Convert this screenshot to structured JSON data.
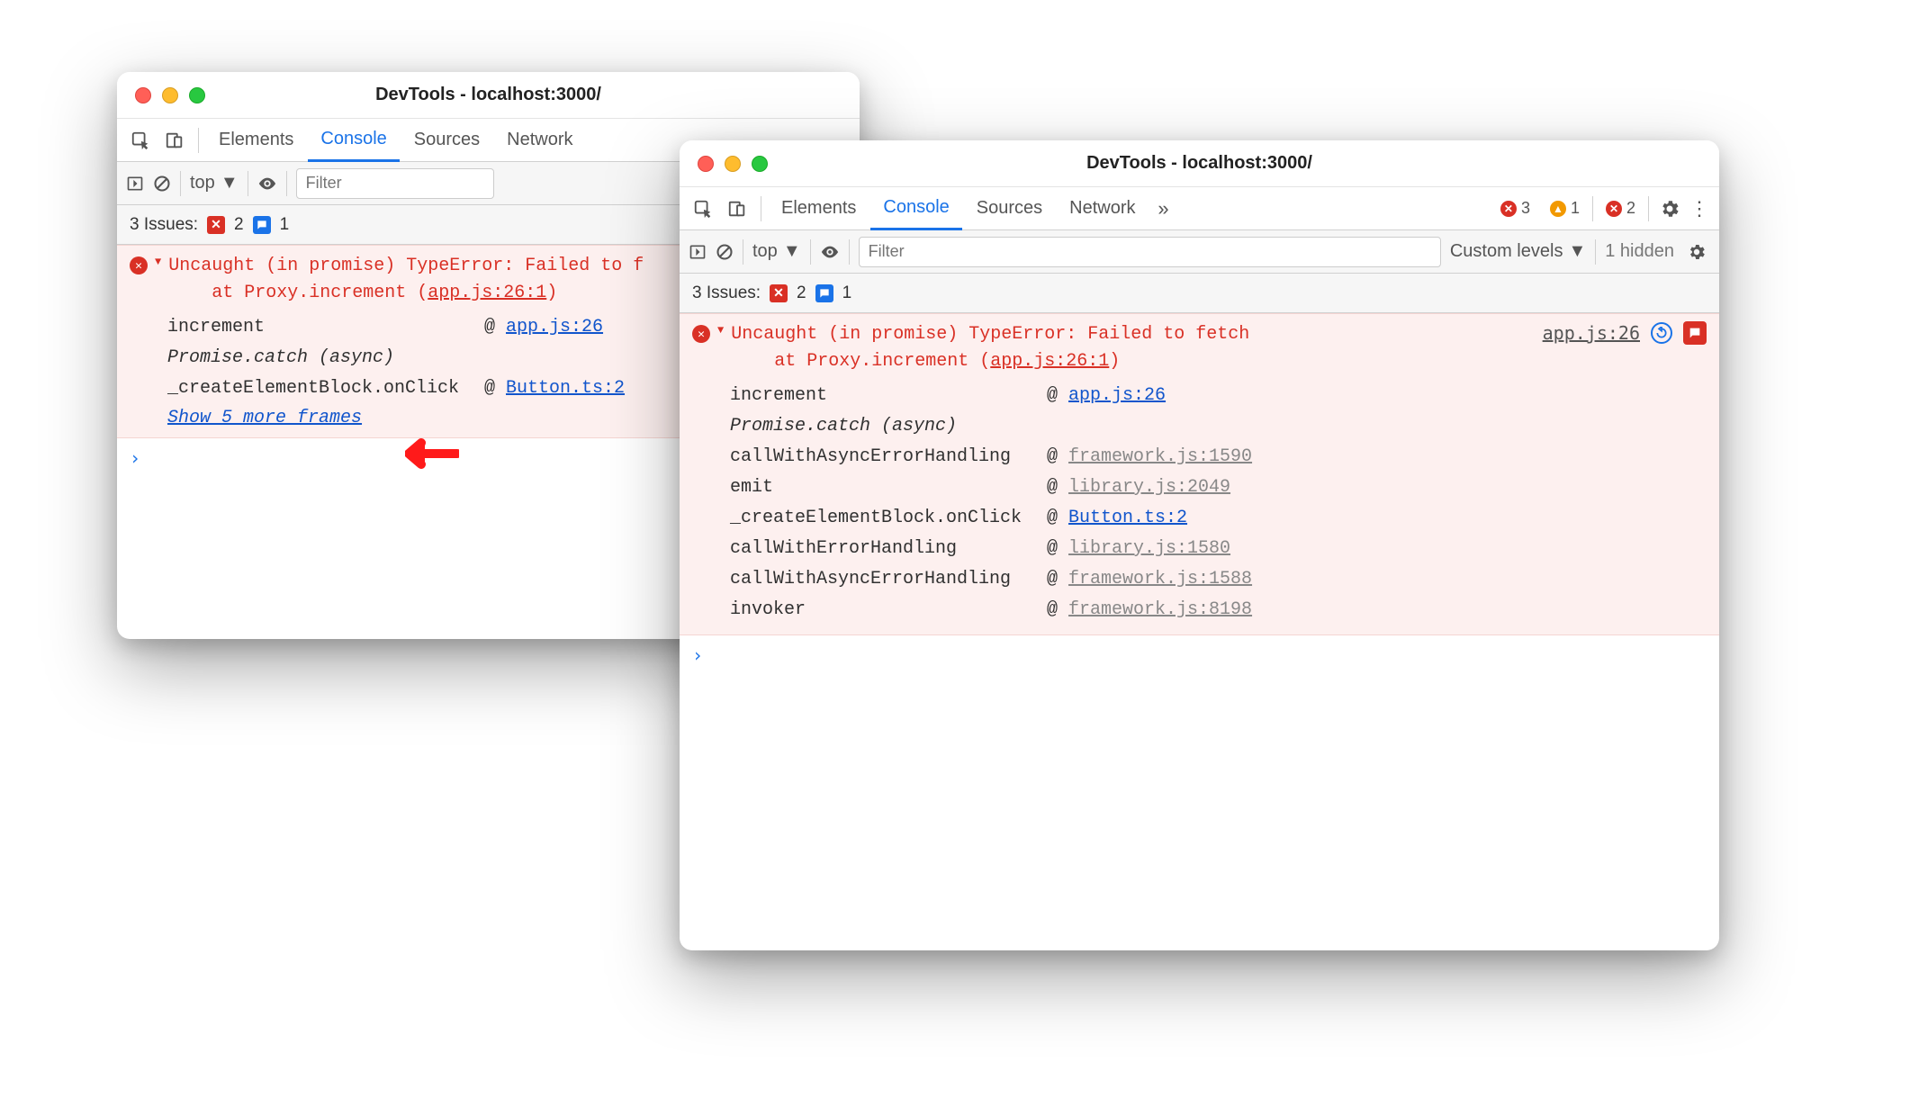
{
  "windowA": {
    "title": "DevTools - localhost:3000/",
    "tabs": [
      "Elements",
      "Console",
      "Sources",
      "Network"
    ],
    "activeTab": "Console",
    "context": "top",
    "filterPlaceholder": "Filter",
    "issuesLabel": "3 Issues:",
    "issueErrCount": "2",
    "issueInfoCount": "1",
    "error": {
      "headline": "Uncaught (in promise) TypeError: Failed to f",
      "atLine": "at Proxy.increment (",
      "srcRef": "app.js:26:1",
      "stack": [
        {
          "fn": "increment",
          "at": "@",
          "link": "app.js:26",
          "grey": false,
          "italic": false
        },
        {
          "fn": "Promise.catch (async)",
          "at": "",
          "link": "",
          "grey": false,
          "italic": true
        },
        {
          "fn": "_createElementBlock.onClick",
          "at": "@",
          "link": "Button.ts:2",
          "grey": false,
          "italic": false
        }
      ],
      "showMore": "Show 5 more frames"
    },
    "promptChar": "›"
  },
  "windowB": {
    "title": "DevTools - localhost:3000/",
    "tabs": [
      "Elements",
      "Console",
      "Sources",
      "Network"
    ],
    "activeTab": "Console",
    "context": "top",
    "filterPlaceholder": "Filter",
    "levelsLabel": "Custom levels",
    "hiddenLabel": "1 hidden",
    "statusErr": "3",
    "statusWarn": "1",
    "statusMsg": "2",
    "issuesLabel": "3 Issues:",
    "issueErrCount": "2",
    "issueInfoCount": "1",
    "error": {
      "headline": "Uncaught (in promise) TypeError: Failed to fetch",
      "atLine": "at Proxy.increment (",
      "srcRef": "app.js:26:1",
      "srcRight": "app.js:26",
      "stack": [
        {
          "fn": "increment",
          "at": "@",
          "link": "app.js:26",
          "grey": false,
          "italic": false
        },
        {
          "fn": "Promise.catch (async)",
          "at": "",
          "link": "",
          "grey": false,
          "italic": true
        },
        {
          "fn": "callWithAsyncErrorHandling",
          "at": "@",
          "link": "framework.js:1590",
          "grey": true,
          "italic": false
        },
        {
          "fn": "emit",
          "at": "@",
          "link": "library.js:2049",
          "grey": true,
          "italic": false
        },
        {
          "fn": "_createElementBlock.onClick",
          "at": "@",
          "link": "Button.ts:2",
          "grey": false,
          "italic": false
        },
        {
          "fn": "callWithErrorHandling",
          "at": "@",
          "link": "library.js:1580",
          "grey": true,
          "italic": false
        },
        {
          "fn": "callWithAsyncErrorHandling",
          "at": "@",
          "link": "framework.js:1588",
          "grey": true,
          "italic": false
        },
        {
          "fn": "invoker",
          "at": "@",
          "link": "framework.js:8198",
          "grey": true,
          "italic": false
        }
      ]
    },
    "promptChar": "›"
  }
}
